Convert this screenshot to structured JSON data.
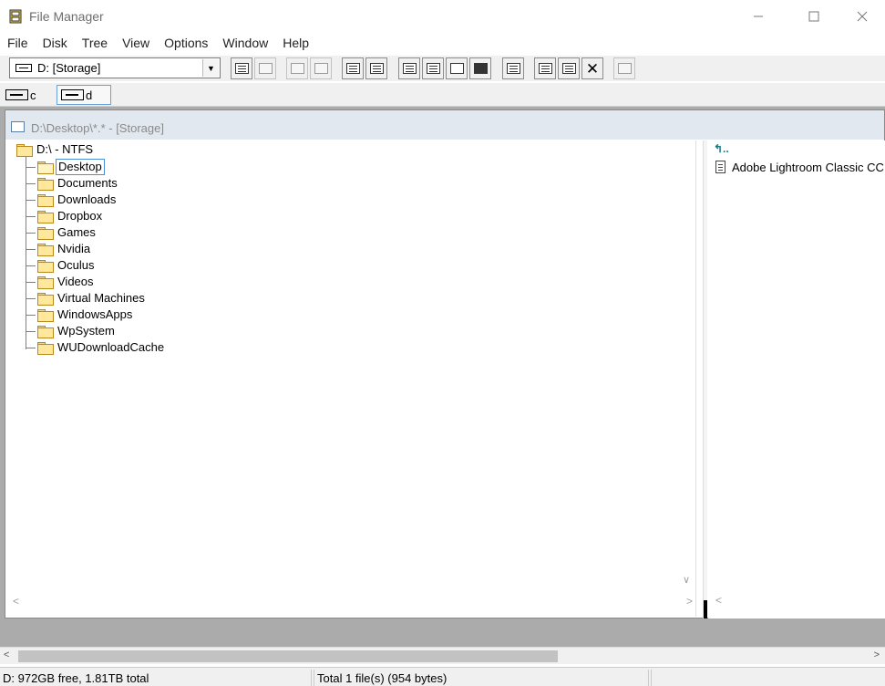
{
  "window": {
    "title": "File Manager",
    "min_icon": "minimize-icon",
    "max_icon": "maximize-icon",
    "close_icon": "close-icon"
  },
  "menu": [
    "File",
    "Disk",
    "Tree",
    "View",
    "Options",
    "Window",
    "Help"
  ],
  "toolbar": {
    "drive_combo_value": "D: [Storage]"
  },
  "drives": [
    {
      "letter": "c",
      "active": false
    },
    {
      "letter": "d",
      "active": true
    }
  ],
  "child_window": {
    "title": "D:\\Desktop\\*.* - [Storage]"
  },
  "tree": {
    "root": "D:\\ - NTFS",
    "folders": [
      "Desktop",
      "Documents",
      "Downloads",
      "Dropbox",
      "Games",
      "Nvidia",
      "Oculus",
      "Videos",
      "Virtual Machines",
      "WindowsApps",
      "WpSystem",
      "WUDownloadCache"
    ],
    "selected": "Desktop"
  },
  "files": {
    "up_link": "↰..",
    "items": [
      "Adobe Lightroom Classic CC.lnk"
    ]
  },
  "status": {
    "free": "D: 972GB free,  1.81TB total",
    "total": "Total 1 file(s) (954 bytes)"
  },
  "colors": {
    "workspace": "#ababab",
    "child_title": "#e2e8ef",
    "selection_border": "#4a90d9",
    "folder": "#ffe79b"
  }
}
